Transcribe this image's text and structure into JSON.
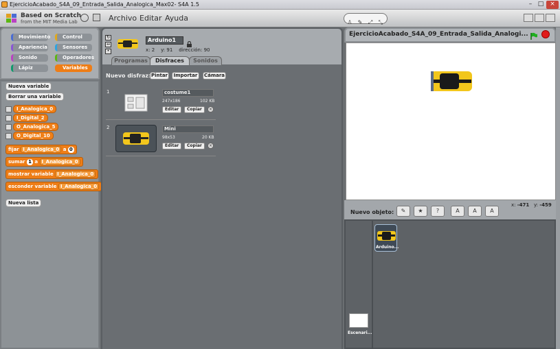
{
  "window": {
    "title": "EjercicioAcabado_S4A_09_Entrada_Salida_Analogica_Max02- S4A 1.5",
    "min": "–",
    "max": "□",
    "close": "×"
  },
  "menubar": {
    "brand_line1": "Based on Scratch",
    "brand_line2": "from the MIT Media Lab",
    "menus": [
      "Archivo",
      "Editar",
      "Ayuda"
    ],
    "mode_icons": [
      "♙",
      "✎",
      "⤢",
      "⤡"
    ]
  },
  "palette": {
    "categories": [
      {
        "label": "Movimiento",
        "color": "#4a6cd4"
      },
      {
        "label": "Control",
        "color": "#e1a91a"
      },
      {
        "label": "Apariencia",
        "color": "#8a55d7"
      },
      {
        "label": "Sensores",
        "color": "#2ca5e2"
      },
      {
        "label": "Sonido",
        "color": "#bb42c3"
      },
      {
        "label": "Operadores",
        "color": "#5cb712"
      },
      {
        "label": "Lápiz",
        "color": "#0e9a6c"
      },
      {
        "label": "Variables",
        "color": "#ee7d16"
      }
    ],
    "new_variable": "Nueva variable",
    "delete_variable": "Borrar una variable",
    "variables": [
      "I_Analogica_0",
      "I_Digital_2",
      "O_Analogica_5",
      "O_Digital_10"
    ],
    "blocks": {
      "set_label": "fijar",
      "set_var": "I_Analogica_0",
      "set_to": "a",
      "set_value": "0",
      "change_label": "sumar",
      "change_value": "1",
      "change_to": "a",
      "change_var": "I_Analogica_0",
      "show_label": "mostrar variable",
      "show_var": "I_Analogica_0",
      "hide_label": "esconder variable",
      "hide_var": "I_Analogica_0"
    },
    "new_list": "Nueva lista"
  },
  "sprite": {
    "name": "Arduino1",
    "x_label": "x:",
    "x": "2",
    "y_label": "y:",
    "y": "91",
    "dir_label": "dirección:",
    "direction": "90",
    "tabs": [
      "Programas",
      "Disfraces",
      "Sonidos"
    ],
    "active_tab": "Disfraces"
  },
  "costumes": {
    "new_label": "Nuevo disfraz:",
    "paint": "Pintar",
    "import": "Importar",
    "camera": "Cámara",
    "items": [
      {
        "num": "1",
        "name": "costume1",
        "dims": "247x186",
        "size": "102 KB",
        "edit": "Editar",
        "copy": "Copiar"
      },
      {
        "num": "2",
        "name": "Mini",
        "dims": "98x53",
        "size": "20 KB",
        "edit": "Editar",
        "copy": "Copiar"
      }
    ]
  },
  "stage": {
    "title": "EjercicioAcabado_S4A_09_Entrada_Salida_Analogi...",
    "mouse_x_label": "x:",
    "mouse_x": "-471",
    "mouse_y_label": "y:",
    "mouse_y": "-459",
    "new_sprite_label": "Nuevo objeto:",
    "sprites": [
      {
        "name": "Arduino..."
      }
    ],
    "stage_thumb_label": "Escenari..."
  },
  "colors": {
    "variables_orange": "#ee7d16",
    "green_flag": "#1fae1f",
    "stop": "#e01b1b"
  }
}
